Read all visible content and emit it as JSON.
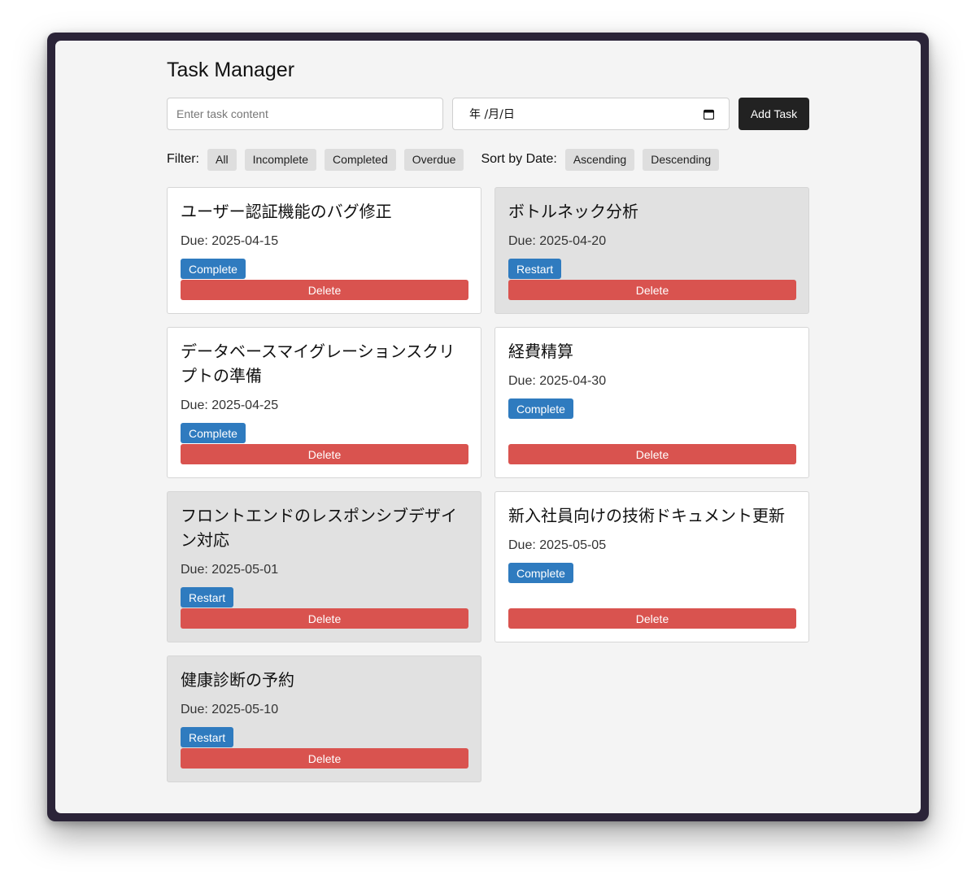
{
  "app": {
    "title": "Task Manager"
  },
  "add_form": {
    "task_placeholder": "Enter task content",
    "date_placeholder": "年 /月/日",
    "add_label": "Add Task"
  },
  "filter": {
    "label": "Filter:",
    "options": [
      "All",
      "Incomplete",
      "Completed",
      "Overdue"
    ]
  },
  "sort": {
    "label": "Sort by Date:",
    "options": [
      "Ascending",
      "Descending"
    ]
  },
  "delete_label": "Delete",
  "tasks": [
    {
      "title": "ユーザー認証機能のバグ修正",
      "due": "Due: 2025-04-15",
      "status": "incomplete",
      "action": "Complete"
    },
    {
      "title": "ボトルネック分析",
      "due": "Due: 2025-04-20",
      "status": "completed",
      "action": "Restart"
    },
    {
      "title": "データベースマイグレーションスクリプトの準備",
      "due": "Due: 2025-04-25",
      "status": "incomplete",
      "action": "Complete"
    },
    {
      "title": "経費精算",
      "due": "Due: 2025-04-30",
      "status": "incomplete",
      "action": "Complete"
    },
    {
      "title": "フロントエンドのレスポンシブデザイン対応",
      "due": "Due: 2025-05-01",
      "status": "completed",
      "action": "Restart"
    },
    {
      "title": "新入社員向けの技術ドキュメント更新",
      "due": "Due: 2025-05-05",
      "status": "incomplete",
      "action": "Complete"
    },
    {
      "title": "健康診断の予約",
      "due": "Due: 2025-05-10",
      "status": "completed",
      "action": "Restart"
    }
  ],
  "colors": {
    "complete_button": "#2f7bbf",
    "delete_button": "#d9534f",
    "add_button": "#222222",
    "completed_card": "#e1e1e1",
    "incomplete_card": "#ffffff"
  }
}
